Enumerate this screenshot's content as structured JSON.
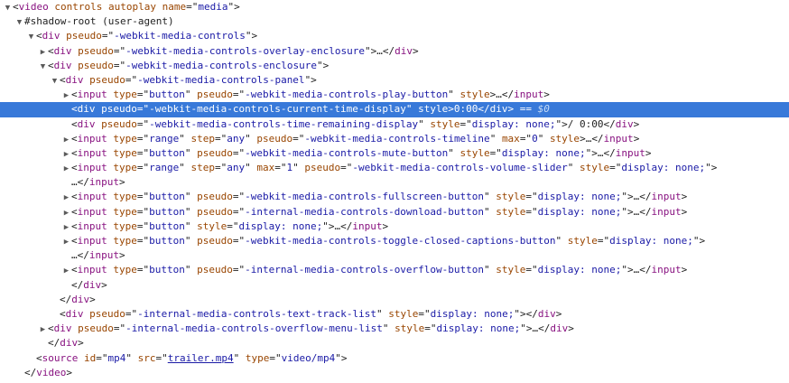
{
  "lines": [
    {
      "indent": 0,
      "tri": "expanded",
      "html": "&lt;<span class='tag'>video</span> <span class='an'>controls</span> <span class='an'>autoplay</span> <span class='an'>name</span>=\"<span class='av'>media</span>\"&gt;"
    },
    {
      "indent": 1,
      "tri": "expanded",
      "html": "<span class='shadow'>#shadow-root (user-agent)</span>"
    },
    {
      "indent": 2,
      "tri": "expanded",
      "html": "&lt;<span class='tag'>div</span> <span class='an'>pseudo</span>=\"<span class='av'>-webkit-media-controls</span>\"&gt;"
    },
    {
      "indent": 3,
      "tri": "collapsed",
      "html": "&lt;<span class='tag'>div</span> <span class='an'>pseudo</span>=\"<span class='av'>-webkit-media-controls-overlay-enclosure</span>\"&gt;<span class='ell'>…</span>&lt;/<span class='tag'>div</span>&gt;"
    },
    {
      "indent": 3,
      "tri": "expanded",
      "html": "&lt;<span class='tag'>div</span> <span class='an'>pseudo</span>=\"<span class='av'>-webkit-media-controls-enclosure</span>\"&gt;"
    },
    {
      "indent": 4,
      "tri": "expanded",
      "html": "&lt;<span class='tag'>div</span> <span class='an'>pseudo</span>=\"<span class='av'>-webkit-media-controls-panel</span>\"&gt;"
    },
    {
      "indent": 5,
      "tri": "collapsed",
      "html": "&lt;<span class='tag'>input</span> <span class='an'>type</span>=\"<span class='av'>button</span>\" <span class='an'>pseudo</span>=\"<span class='av'>-webkit-media-controls-play-button</span>\" <span class='an'>style</span>&gt;<span class='ell'>…</span>&lt;/<span class='tag'>input</span>&gt;"
    },
    {
      "indent": 5,
      "tri": "none",
      "selected": true,
      "html": "&lt;<span class='tag'>div</span> <span class='an'>pseudo</span>=\"<span class='av'>-webkit-media-controls-current-time-display</span>\" <span class='an'>style</span>&gt;<span class='txt'>0:00</span>&lt;/<span class='tag'>div</span>&gt; == <span class='dollar0'>$0</span>"
    },
    {
      "indent": 5,
      "tri": "none",
      "html": "&lt;<span class='tag'>div</span> <span class='an'>pseudo</span>=\"<span class='av'>-webkit-media-controls-time-remaining-display</span>\" <span class='an'>style</span>=\"<span class='av'>display: none;</span>\"&gt;<span class='txt'>/ 0:00</span>&lt;/<span class='tag'>div</span>&gt;"
    },
    {
      "indent": 5,
      "tri": "collapsed",
      "html": "&lt;<span class='tag'>input</span> <span class='an'>type</span>=\"<span class='av'>range</span>\" <span class='an'>step</span>=\"<span class='av'>any</span>\" <span class='an'>pseudo</span>=\"<span class='av'>-webkit-media-controls-timeline</span>\" <span class='an'>max</span>=\"<span class='av'>0</span>\" <span class='an'>style</span>&gt;<span class='ell'>…</span>&lt;/<span class='tag'>input</span>&gt;"
    },
    {
      "indent": 5,
      "tri": "collapsed",
      "html": "&lt;<span class='tag'>input</span> <span class='an'>type</span>=\"<span class='av'>button</span>\" <span class='an'>pseudo</span>=\"<span class='av'>-webkit-media-controls-mute-button</span>\" <span class='an'>style</span>=\"<span class='av'>display: none;</span>\"&gt;<span class='ell'>…</span>&lt;/<span class='tag'>input</span>&gt;"
    },
    {
      "indent": 5,
      "tri": "collapsed",
      "html": "&lt;<span class='tag'>input</span> <span class='an'>type</span>=\"<span class='av'>range</span>\" <span class='an'>step</span>=\"<span class='av'>any</span>\" <span class='an'>max</span>=\"<span class='av'>1</span>\" <span class='an'>pseudo</span>=\"<span class='av'>-webkit-media-controls-volume-slider</span>\" <span class='an'>style</span>=\"<span class='av'>display: none;</span>\"&gt;"
    },
    {
      "indent": 5,
      "tri": "none",
      "cont": true,
      "html": "<span class='ell'>…</span>&lt;/<span class='tag'>input</span>&gt;"
    },
    {
      "indent": 5,
      "tri": "collapsed",
      "html": "&lt;<span class='tag'>input</span> <span class='an'>type</span>=\"<span class='av'>button</span>\" <span class='an'>pseudo</span>=\"<span class='av'>-webkit-media-controls-fullscreen-button</span>\" <span class='an'>style</span>=\"<span class='av'>display: none;</span>\"&gt;<span class='ell'>…</span>&lt;/<span class='tag'>input</span>&gt;"
    },
    {
      "indent": 5,
      "tri": "collapsed",
      "html": "&lt;<span class='tag'>input</span> <span class='an'>type</span>=\"<span class='av'>button</span>\" <span class='an'>pseudo</span>=\"<span class='av'>-internal-media-controls-download-button</span>\" <span class='an'>style</span>=\"<span class='av'>display: none;</span>\"&gt;<span class='ell'>…</span>&lt;/<span class='tag'>input</span>&gt;"
    },
    {
      "indent": 5,
      "tri": "collapsed",
      "html": "&lt;<span class='tag'>input</span> <span class='an'>type</span>=\"<span class='av'>button</span>\" <span class='an'>style</span>=\"<span class='av'>display: none;</span>\"&gt;<span class='ell'>…</span>&lt;/<span class='tag'>input</span>&gt;"
    },
    {
      "indent": 5,
      "tri": "collapsed",
      "html": "&lt;<span class='tag'>input</span> <span class='an'>type</span>=\"<span class='av'>button</span>\" <span class='an'>pseudo</span>=\"<span class='av'>-webkit-media-controls-toggle-closed-captions-button</span>\" <span class='an'>style</span>=\"<span class='av'>display: none;</span>\"&gt;"
    },
    {
      "indent": 5,
      "tri": "none",
      "cont": true,
      "html": "<span class='ell'>…</span>&lt;/<span class='tag'>input</span>&gt;"
    },
    {
      "indent": 5,
      "tri": "collapsed",
      "html": "&lt;<span class='tag'>input</span> <span class='an'>type</span>=\"<span class='av'>button</span>\" <span class='an'>pseudo</span>=\"<span class='av'>-internal-media-controls-overflow-button</span>\" <span class='an'>style</span>=\"<span class='av'>display: none;</span>\"&gt;<span class='ell'>…</span>&lt;/<span class='tag'>input</span>&gt;"
    },
    {
      "indent": 5,
      "tri": "none",
      "html": "&lt;/<span class='tag'>div</span>&gt;"
    },
    {
      "indent": 4,
      "tri": "none",
      "html": "&lt;/<span class='tag'>div</span>&gt;"
    },
    {
      "indent": 4,
      "tri": "none",
      "html": "&lt;<span class='tag'>div</span> <span class='an'>pseudo</span>=\"<span class='av'>-internal-media-controls-text-track-list</span>\" <span class='an'>style</span>=\"<span class='av'>display: none;</span>\"&gt;&lt;/<span class='tag'>div</span>&gt;"
    },
    {
      "indent": 3,
      "tri": "collapsed",
      "html": "&lt;<span class='tag'>div</span> <span class='an'>pseudo</span>=\"<span class='av'>-internal-media-controls-overflow-menu-list</span>\" <span class='an'>style</span>=\"<span class='av'>display: none;</span>\"&gt;<span class='ell'>…</span>&lt;/<span class='tag'>div</span>&gt;"
    },
    {
      "indent": 3,
      "tri": "none",
      "html": "&lt;/<span class='tag'>div</span>&gt;"
    },
    {
      "indent": 2,
      "tri": "none",
      "html": "&lt;<span class='tag'>source</span> <span class='an'>id</span>=\"<span class='av'>mp4</span>\" <span class='an'>src</span>=\"<span class='av link'>trailer.mp4</span>\" <span class='an'>type</span>=\"<span class='av'>video/mp4</span>\"&gt;"
    },
    {
      "indent": 1,
      "tri": "none",
      "html": "&lt;/<span class='tag'>video</span>&gt;"
    }
  ]
}
